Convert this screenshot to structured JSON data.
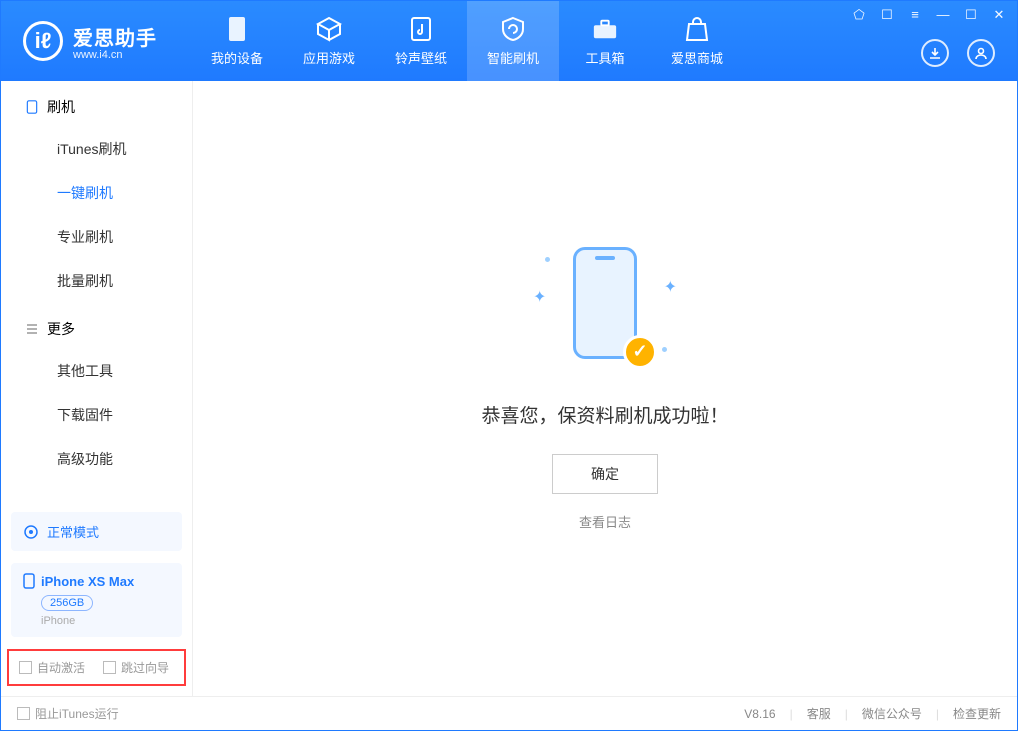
{
  "app": {
    "name": "爱思助手",
    "site": "www.i4.cn"
  },
  "tabs": {
    "device": "我的设备",
    "apps": "应用游戏",
    "ringtone": "铃声壁纸",
    "flash": "智能刷机",
    "toolbox": "工具箱",
    "store": "爱思商城"
  },
  "sidebar": {
    "section1": "刷机",
    "items1": {
      "itunes": "iTunes刷机",
      "onekey": "一键刷机",
      "pro": "专业刷机",
      "batch": "批量刷机"
    },
    "section2": "更多",
    "items2": {
      "other": "其他工具",
      "firmware": "下载固件",
      "advanced": "高级功能"
    }
  },
  "mode": {
    "label": "正常模式"
  },
  "device": {
    "name": "iPhone XS Max",
    "storage": "256GB",
    "type": "iPhone"
  },
  "checkboxes": {
    "autoActivate": "自动激活",
    "skipGuide": "跳过向导"
  },
  "result": {
    "message": "恭喜您，保资料刷机成功啦！",
    "ok": "确定",
    "viewLog": "查看日志"
  },
  "statusbar": {
    "blockItunes": "阻止iTunes运行",
    "version": "V8.16",
    "cs": "客服",
    "wechat": "微信公众号",
    "update": "检查更新"
  }
}
